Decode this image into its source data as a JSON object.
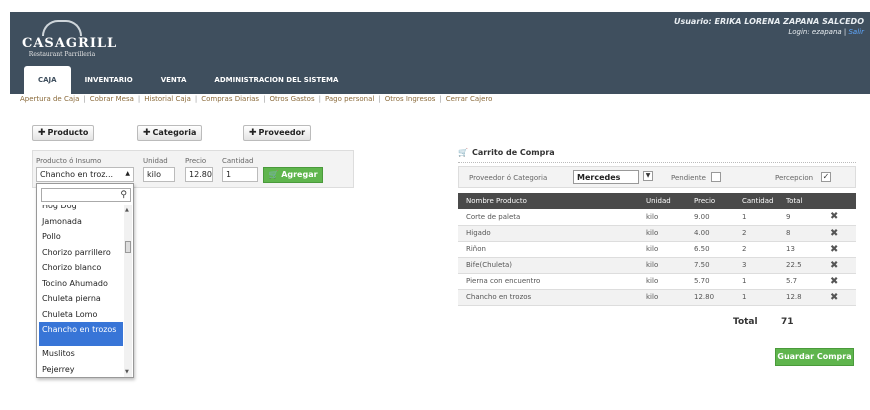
{
  "brand": {
    "name": "CASAGRILL",
    "subtitle": "Restaurant Parrilleria"
  },
  "user": {
    "label": "Usuario: ERIKA LORENA ZAPANA SALCEDO",
    "login": "Login: ezapana |",
    "logout": "Salir"
  },
  "tabs": [
    {
      "label": "CAJA",
      "active": true
    },
    {
      "label": "INVENTARIO",
      "active": false
    },
    {
      "label": "VENTA",
      "active": false
    },
    {
      "label": "ADMINISTRACION DEL SISTEMA",
      "active": false
    }
  ],
  "subnav": [
    "Apertura de Caja",
    "Cobrar Mesa",
    "Historial Caja",
    "Compras Diarias",
    "Otros Gastos",
    "Pago personal",
    "Otros Ingresos",
    "Cerrar Cajero"
  ],
  "actions": {
    "producto": "Producto",
    "categoria": "Categoria",
    "proveedor": "Proveedor"
  },
  "form": {
    "producto_label": "Producto ó Insumo",
    "producto_value": "Chancho en troz...",
    "unidad_label": "Unidad",
    "unidad_value": "kilo",
    "precio_label": "Precio",
    "precio_value": "12.80",
    "cantidad_label": "Cantidad",
    "cantidad_value": "1",
    "agregar": "Agregar"
  },
  "dropdown": {
    "items": [
      "Hog Dog",
      "Jamonada",
      "Pollo",
      "Chorizo parrillero",
      "Chorizo blanco",
      "Tocino Ahumado",
      "Chuleta pierna",
      "Chuleta Lomo",
      "Chancho en trozos",
      "Muslitos",
      "Pejerrey"
    ],
    "selected": "Chancho en trozos"
  },
  "cart": {
    "title": "Carrito de Compra",
    "proveedor_label": "Proveedor ó Categoria",
    "proveedor_value": "Mercedes",
    "pendiente_label": "Pendiente",
    "pendiente_checked": false,
    "percepcion_label": "Percepcion",
    "percepcion_checked": true,
    "columns": [
      "Nombre Producto",
      "Unidad",
      "Precio",
      "Cantidad",
      "Total"
    ],
    "rows": [
      {
        "nombre": "Corte de paleta",
        "unidad": "kilo",
        "precio": "9.00",
        "cantidad": "1",
        "total": "9"
      },
      {
        "nombre": "Higado",
        "unidad": "kilo",
        "precio": "4.00",
        "cantidad": "2",
        "total": "8"
      },
      {
        "nombre": "Riñon",
        "unidad": "kilo",
        "precio": "6.50",
        "cantidad": "2",
        "total": "13"
      },
      {
        "nombre": "Bife(Chuleta)",
        "unidad": "kilo",
        "precio": "7.50",
        "cantidad": "3",
        "total": "22.5"
      },
      {
        "nombre": "Pierna con encuentro",
        "unidad": "kilo",
        "precio": "5.70",
        "cantidad": "1",
        "total": "5.7"
      },
      {
        "nombre": "Chancho en trozos",
        "unidad": "kilo",
        "precio": "12.80",
        "cantidad": "1",
        "total": "12.8"
      }
    ],
    "total_label": "Total",
    "total_value": "71",
    "guardar": "Guardar Compra"
  }
}
